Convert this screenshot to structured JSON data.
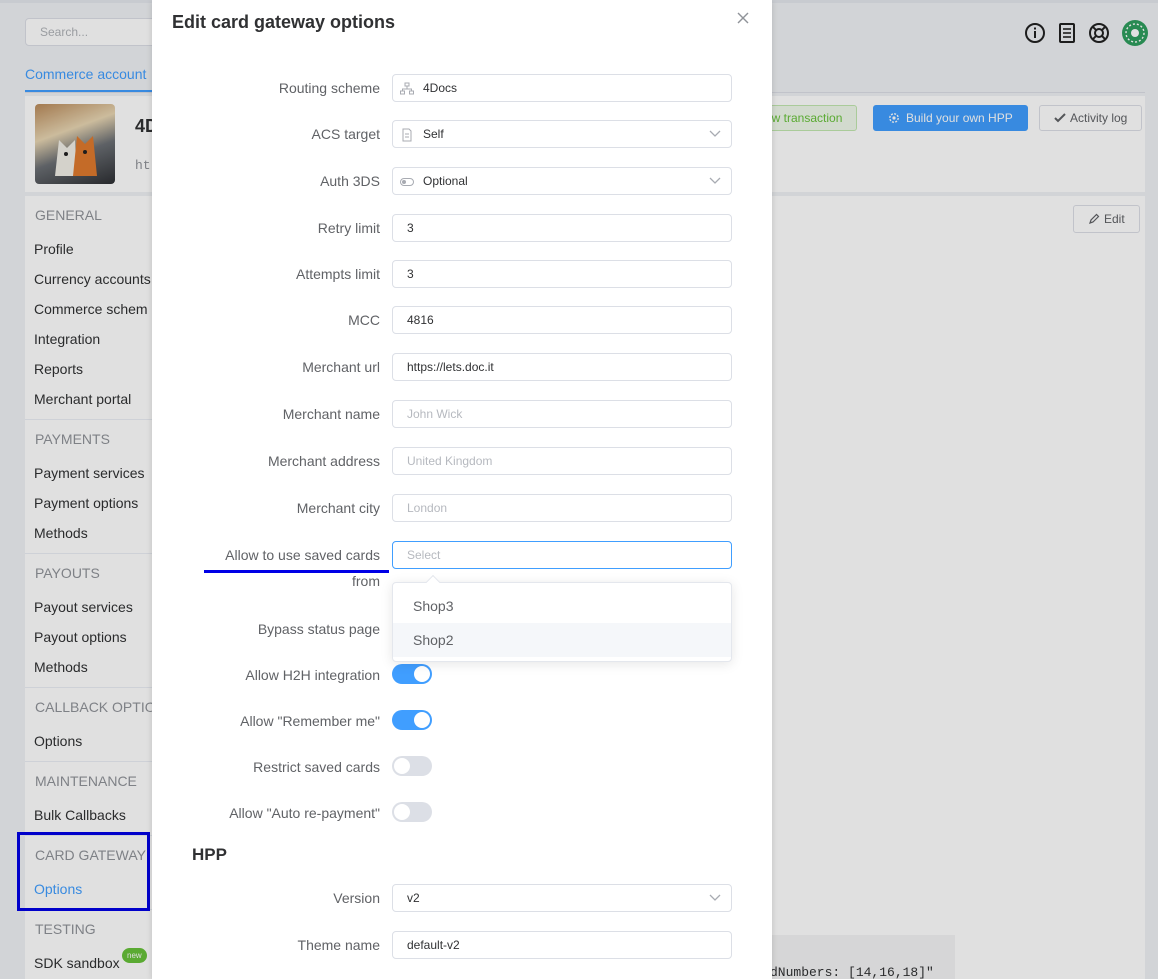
{
  "background": {
    "search_placeholder": "Search...",
    "commerce_tab": "Commerce account",
    "merchant_abbr": "4D",
    "merchant_url_fragment": "ht",
    "buttons": {
      "new_transaction": "ew transaction",
      "build_hpp": "Build your own HPP",
      "activity_log": "Activity log",
      "edit": "Edit"
    },
    "code_fragment": "dNumbers: [14,16,18]\"",
    "sidebar": {
      "general": "GENERAL",
      "general_items": [
        "Profile",
        "Currency accounts",
        "Commerce schem",
        "Integration",
        "Reports",
        "Merchant portal"
      ],
      "payments": "PAYMENTS",
      "payments_items": [
        "Payment services",
        "Payment options",
        "Methods"
      ],
      "payouts": "PAYOUTS",
      "payouts_items": [
        "Payout services",
        "Payout options",
        "Methods"
      ],
      "callback": "CALLBACK OPTION",
      "callback_items": [
        "Options"
      ],
      "maintenance": "MAINTENANCE",
      "maintenance_items": [
        "Bulk Callbacks"
      ],
      "card_gateway": "CARD GATEWAY",
      "card_gateway_items": [
        "Options"
      ],
      "testing": "TESTING",
      "testing_items": [
        "SDK sandbox"
      ],
      "new_badge": "new"
    }
  },
  "modal": {
    "title": "Edit card gateway options",
    "fields": {
      "routing_scheme": {
        "label": "Routing scheme",
        "value": "4Docs"
      },
      "acs_target": {
        "label": "ACS target",
        "value": "Self"
      },
      "auth_3ds": {
        "label": "Auth 3DS",
        "value": "Optional"
      },
      "retry_limit": {
        "label": "Retry limit",
        "value": "3"
      },
      "attempts_limit": {
        "label": "Attempts limit",
        "value": "3"
      },
      "mcc": {
        "label": "MCC",
        "value": "4816"
      },
      "merchant_url": {
        "label": "Merchant url",
        "value": "https://lets.doc.it"
      },
      "merchant_name": {
        "label": "Merchant name",
        "placeholder": "John Wick"
      },
      "merchant_address": {
        "label": "Merchant address",
        "placeholder": "United Kingdom"
      },
      "merchant_city": {
        "label": "Merchant city",
        "placeholder": "London"
      },
      "saved_cards_from": {
        "label_line1": "Allow to use saved cards",
        "label_line2": "from",
        "placeholder": "Select",
        "options": [
          "Shop3",
          "Shop2"
        ]
      },
      "bypass_status_page": {
        "label": "Bypass status page"
      },
      "allow_h2h": {
        "label": "Allow H2H integration",
        "on": true
      },
      "allow_remember_me": {
        "label": "Allow \"Remember me\"",
        "on": true
      },
      "restrict_saved_cards": {
        "label": "Restrict saved cards",
        "on": false
      },
      "allow_auto_repayment": {
        "label": "Allow \"Auto re-payment\"",
        "on": false
      }
    },
    "hpp_section": "HPP",
    "hpp": {
      "version": {
        "label": "Version",
        "value": "v2"
      },
      "theme_name": {
        "label": "Theme name",
        "value": "default-v2"
      }
    }
  }
}
